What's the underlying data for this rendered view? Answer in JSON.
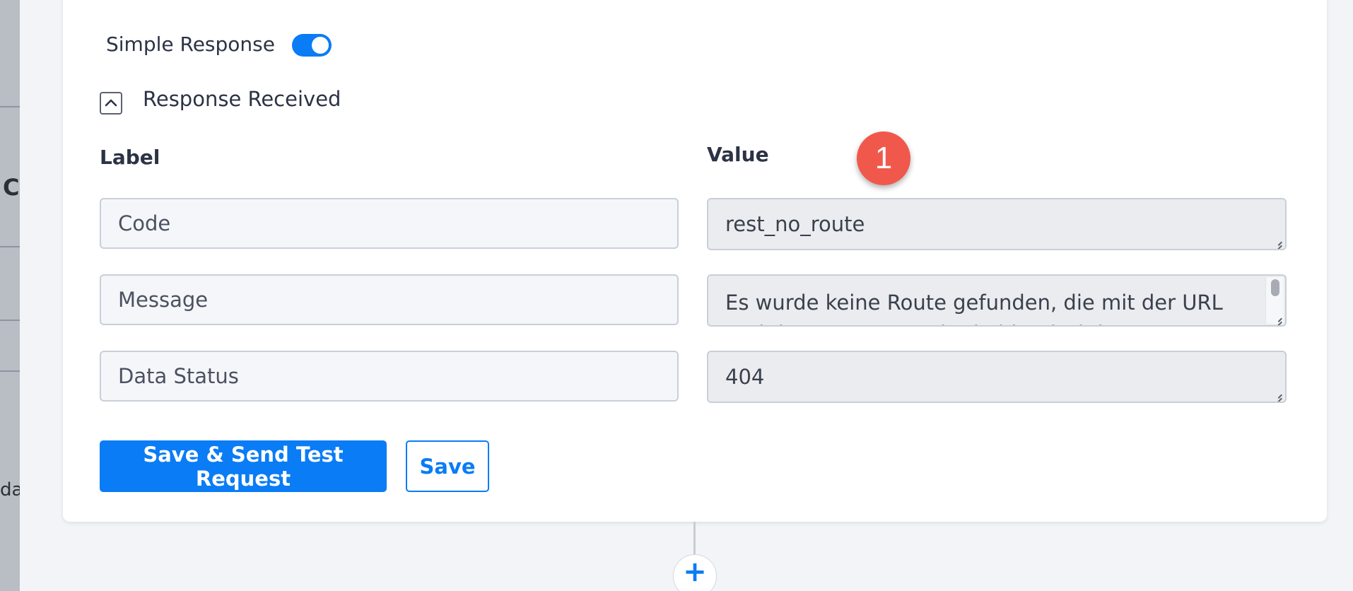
{
  "background": {
    "left_fragments": [
      "C",
      "da"
    ]
  },
  "response": {
    "simple_response_label": "Simple Response",
    "simple_response_enabled": true,
    "section_title": "Response Received",
    "collapse_glyph": "^",
    "headers": {
      "label": "Label",
      "value": "Value"
    },
    "rows": [
      {
        "label": "Code",
        "value": "rest_no_route"
      },
      {
        "label": "Message",
        "value": "Es wurde keine Route gefunden, die mit der URL und der Request-Methode identisch ist."
      },
      {
        "label": "Data Status",
        "value": "404"
      }
    ]
  },
  "annotation": {
    "badge_number": "1"
  },
  "actions": {
    "save_and_send_label": "Save & Send Test Request",
    "save_label": "Save",
    "add_step_glyph": "+"
  },
  "colors": {
    "primary": "#0a7cf5",
    "badge": "#f1584c"
  },
  "icons": {
    "collapse": "chevron-up-icon",
    "add": "plus-icon",
    "resize": "resize-handle-icon"
  }
}
